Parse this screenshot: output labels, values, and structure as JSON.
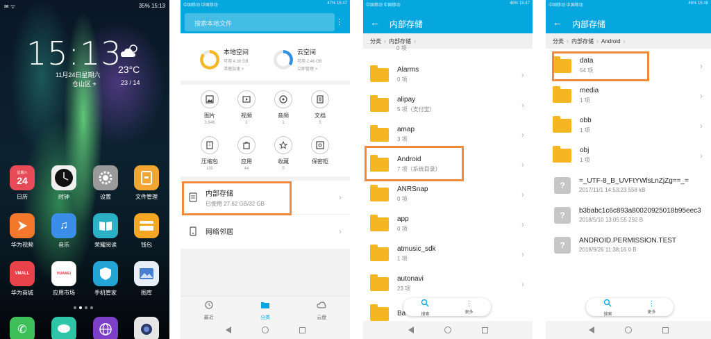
{
  "home": {
    "status_left": "✉ ᯤ",
    "status_right": "35% 15:13",
    "time": "15:13",
    "date": "11月24日星期六",
    "location": "仓山区",
    "temperature": "23°C",
    "temp_range": "23 / 14",
    "calendar_num": "24",
    "calendar_top": "星期六",
    "apps": [
      {
        "label": "日历",
        "icon": "calendar-icon",
        "color": "#e84b58"
      },
      {
        "label": "时钟",
        "icon": "clock-icon",
        "color": "#111111"
      },
      {
        "label": "设置",
        "icon": "gear-icon",
        "color": "#9a9a9a"
      },
      {
        "label": "文件管理",
        "icon": "folder-icon",
        "color": "#f2a531"
      },
      {
        "label": "华为视频",
        "icon": "play-icon",
        "color": "#f4782c"
      },
      {
        "label": "音乐",
        "icon": "music-icon",
        "color": "#3b8ee8"
      },
      {
        "label": "荣耀阅读",
        "icon": "book-icon",
        "color": "#2bb0c6"
      },
      {
        "label": "钱包",
        "icon": "wallet-icon",
        "color": "#f5a623"
      },
      {
        "label": "华为商城",
        "icon": "vmall-icon",
        "color": "#e8434a"
      },
      {
        "label": "应用市场",
        "icon": "appstore-icon",
        "color": "#d9454f"
      },
      {
        "label": "手机管家",
        "icon": "shield-icon",
        "color": "#23a6d6"
      },
      {
        "label": "图库",
        "icon": "gallery-icon",
        "color": "#4a7fcf"
      }
    ],
    "vmall_text": "VMALL",
    "huawei_text": "HUAWEI"
  },
  "fm_home": {
    "status_left": "中国移动 中国移动",
    "status_right": "47% 15:47",
    "search_placeholder": "搜索本地文件",
    "local": {
      "title": "本地空间",
      "line1": "可用 4.38 GB",
      "line2": "清理加速 >"
    },
    "cloud": {
      "title": "云空间",
      "line1": "可用 2.46 GB",
      "line2": "立即管理 >"
    },
    "categories": [
      {
        "label": "图片",
        "count": "3,646",
        "icon": "image-icon"
      },
      {
        "label": "视频",
        "count": "2",
        "icon": "video-icon"
      },
      {
        "label": "音频",
        "count": "1",
        "icon": "audio-icon"
      },
      {
        "label": "文档",
        "count": "5",
        "icon": "document-icon"
      },
      {
        "label": "压缩包",
        "count": "100",
        "icon": "zip-icon"
      },
      {
        "label": "应用",
        "count": "44",
        "icon": "app-bag-icon"
      },
      {
        "label": "收藏",
        "count": "0",
        "icon": "star-icon"
      },
      {
        "label": "保密柜",
        "count": "",
        "icon": "safe-icon"
      }
    ],
    "internal": {
      "title": "内部存储",
      "subtitle": "已使用 27.62 GB/32 GB"
    },
    "network": {
      "title": "网络邻居"
    },
    "tabs": [
      {
        "label": "最近",
        "icon": "clock-icon"
      },
      {
        "label": "分类",
        "icon": "folder-icon"
      },
      {
        "label": "云盘",
        "icon": "cloud-icon"
      }
    ]
  },
  "internal": {
    "status_left": "中国移动 中国移动",
    "status_right": "46% 15:47",
    "title": "内部存储",
    "crumbs": [
      "分类",
      "内部存储"
    ],
    "partial_top": "0 项",
    "folders": [
      {
        "name": "Alarms",
        "info": "0 项"
      },
      {
        "name": "alipay",
        "info": "5 项（支付宝）"
      },
      {
        "name": "amap",
        "info": "3 项"
      },
      {
        "name": "Android",
        "info": "7 项（系统目录）"
      },
      {
        "name": "ANRSnap",
        "info": "0 项"
      },
      {
        "name": "app",
        "info": "0 项"
      },
      {
        "name": "atmusic_sdk",
        "info": "1 项"
      },
      {
        "name": "autonavi",
        "info": "23 项"
      },
      {
        "name": "Ba",
        "info": ""
      }
    ],
    "search_label": "搜索",
    "more_label": "更多"
  },
  "android": {
    "status_left": "中国移动 中国移动",
    "status_right": "46% 15:48",
    "title": "内部存储",
    "crumbs": [
      "分类",
      "内部存储",
      "Android"
    ],
    "folders": [
      {
        "name": "data",
        "info": "54 项"
      },
      {
        "name": "media",
        "info": "1 项"
      },
      {
        "name": "obb",
        "info": "1 项"
      },
      {
        "name": "obj",
        "info": "1 项"
      }
    ],
    "files": [
      {
        "name": "=_UTF-8_B_UVFtYWlsLnZjZg==_=",
        "info": "2017/11/1 14:53:23 558 kB"
      },
      {
        "name": "b3babc1c6c893a80020925018b95eec3",
        "info": "2018/5/10 13:05:55 292 B"
      },
      {
        "name": "ANDROID.PERMISSION.TEST",
        "info": "2018/9/26 11:38:16 0 B"
      }
    ],
    "search_label": "搜索",
    "more_label": "更多"
  },
  "colors": {
    "accent": "#06a7de",
    "folder": "#f5b624",
    "highlight": "#f08a3c"
  }
}
